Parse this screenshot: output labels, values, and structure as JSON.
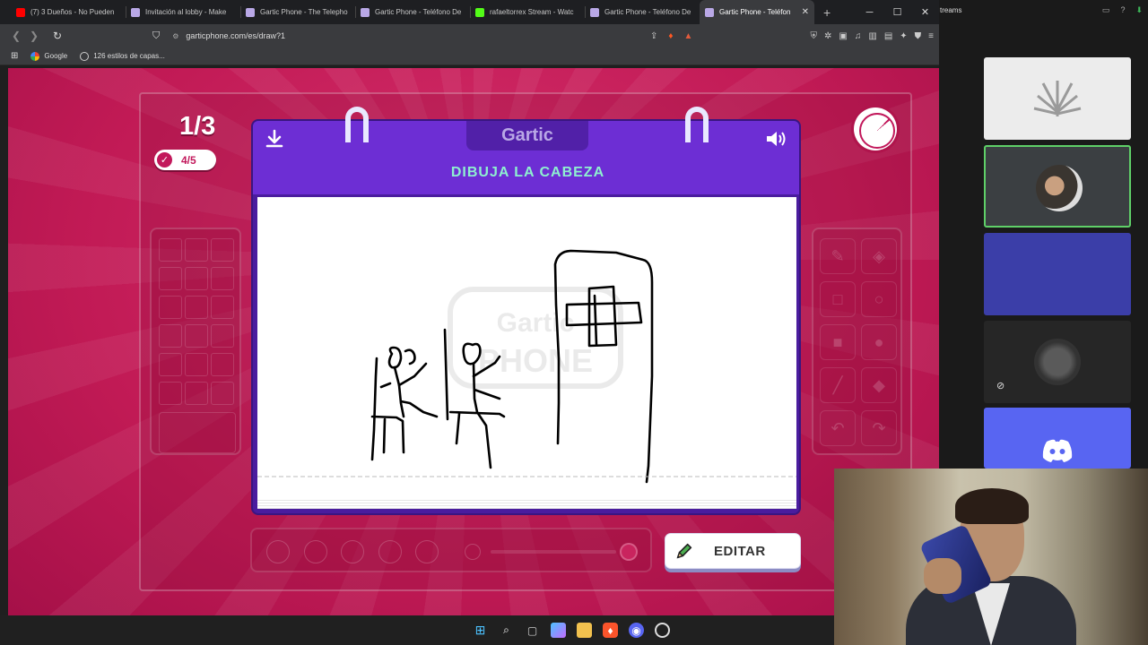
{
  "browser": {
    "tabs": [
      {
        "title": "(7) 3 Dueños - No Pueden",
        "fav": "#ff0000"
      },
      {
        "title": "Invitación al lobby - Make",
        "fav": "#b9a8e6"
      },
      {
        "title": "Gartic Phone - The Telepho",
        "fav": "#b9a8e6"
      },
      {
        "title": "Gartic Phone - Teléfono De",
        "fav": "#b9a8e6"
      },
      {
        "title": "rafaeltorrex Stream - Watc",
        "fav": "#53fc18"
      },
      {
        "title": "Gartic Phone - Teléfono De",
        "fav": "#b9a8e6"
      },
      {
        "title": "Gartic Phone - Teléfon",
        "fav": "#b9a8e6"
      }
    ],
    "url": "garticphone.com/es/draw?1",
    "bookmarks": [
      "Google",
      "126 estilos de capas..."
    ]
  },
  "game": {
    "round": "1/3",
    "done_count": "4/5",
    "logo": "Gartic",
    "task": "DIBUJA LA CABEZA",
    "edit_label": "EDITAR",
    "watermark_top": "Gartic",
    "watermark_bottom": "PHONE"
  },
  "side": {
    "header": "treams"
  },
  "colors": {
    "accent_purple": "#6d2ed4",
    "task_text": "#8ef0d0",
    "page_bg": "#c11a55",
    "discord": "#5865f2"
  }
}
